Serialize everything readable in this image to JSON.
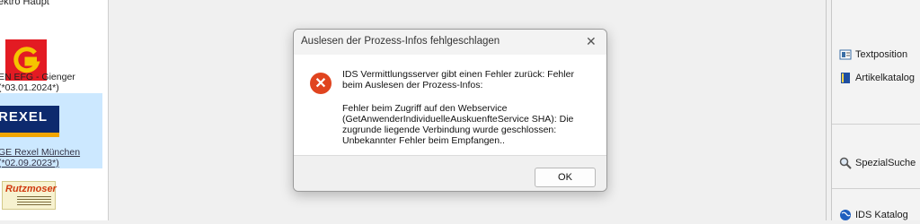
{
  "left_panel": {
    "header_label": "ektro Haupt",
    "suppliers": [
      {
        "label_line1": "EN EFG - Gienger",
        "label_line2": "(*03.01.2024*)",
        "logo": "efg-logo"
      },
      {
        "label_line1": "GE Rexel München",
        "label_line2": "(*02.09.2023*)",
        "logo": "rexel-logo",
        "logo_text": "REXEL"
      },
      {
        "logo": "rutzmoser-logo",
        "logo_text": "Rutzmoser"
      }
    ]
  },
  "dialog": {
    "title": "Auslesen der Prozess-Infos fehlgeschlagen",
    "message_line1": "IDS Vermittlungsserver gibt einen Fehler zurück: Fehler beim Auslesen der Prozess-Infos:",
    "message_line2": "Fehler beim Zugriff auf den Webservice (GetAnwenderIndividuelleAuskuenfteService SHA): Die zugrunde liegende Verbindung wurde geschlossen: Unbekannter Fehler beim Empfangen..",
    "ok_label": "OK",
    "close_glyph": "✕",
    "error_glyph": "✕"
  },
  "right_panel": {
    "items": [
      {
        "label": "Textposition",
        "icon": "text-position-icon"
      },
      {
        "label": "Artikelkatalog",
        "icon": "book-icon"
      },
      {
        "label": "SpezialSuche",
        "icon": "magnifier-icon"
      },
      {
        "label": "IDS Katalog",
        "icon": "globe-icon"
      }
    ]
  },
  "colors": {
    "error_icon": "#e0441f",
    "selected_row": "#cce8ff",
    "rexel_blue": "#0d2a6e"
  }
}
